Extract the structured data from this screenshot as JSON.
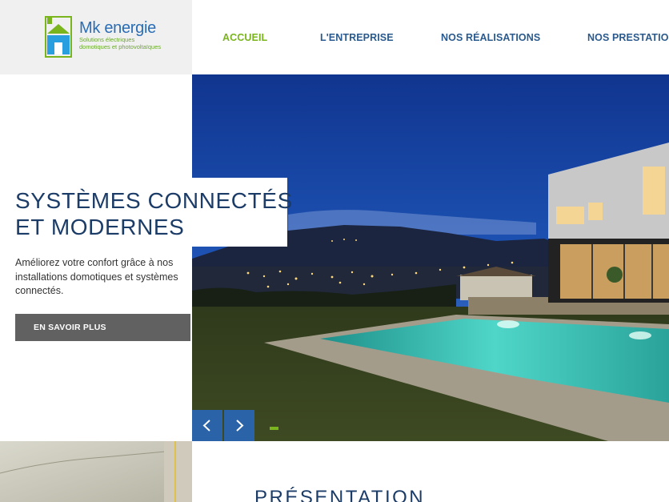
{
  "brand": {
    "name": "Mk energie",
    "tagline_line1": "Solutions électriques",
    "tagline_line2": "domotiques et photovoltaïques",
    "colors": {
      "blue": "#2a6db5",
      "green": "#7ab51d",
      "navy": "#1c3c68"
    }
  },
  "nav": {
    "items": [
      {
        "label": "ACCUEIL",
        "active": true
      },
      {
        "label": "L'ENTREPRISE",
        "active": false
      },
      {
        "label": "NOS RÉALISATIONS",
        "active": false
      },
      {
        "label": "NOS PRESTATIONS",
        "active": false
      }
    ]
  },
  "hero": {
    "title_line1": "SYSTÈMES CONNECTÉS",
    "title_line2": "ET MODERNES",
    "description": "Améliorez votre confort grâce à nos installations domotiques et systèmes connectés.",
    "cta_label": "EN SAVOIR PLUS",
    "prev_icon": "chevron-left-icon",
    "next_icon": "chevron-right-icon",
    "image": "house-with-pool-at-night"
  },
  "presentation": {
    "title": "PRÉSENTATION"
  }
}
